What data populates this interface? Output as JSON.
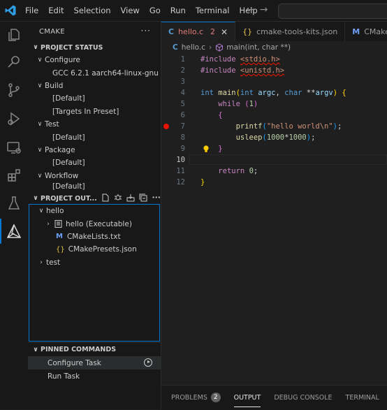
{
  "menu": [
    "File",
    "Edit",
    "Selection",
    "View",
    "Go",
    "Run",
    "Terminal",
    "Help"
  ],
  "sidebar": {
    "title": "CMAKE",
    "project_status": {
      "title": "PROJECT STATUS",
      "sections": [
        {
          "label": "Configure",
          "children": [
            "GCC 6.2.1 aarch64-linux-gnu"
          ]
        },
        {
          "label": "Build",
          "children": [
            "[Default]",
            "[Targets In Preset]"
          ]
        },
        {
          "label": "Test",
          "children": [
            "[Default]"
          ]
        },
        {
          "label": "Package",
          "children": [
            "[Default]"
          ]
        },
        {
          "label": "Workflow",
          "children": [
            "[Default]"
          ]
        }
      ]
    },
    "project_outline": {
      "title": "PROJECT OUT...",
      "items": [
        {
          "label": "hello"
        },
        {
          "label": "hello (Executable)"
        },
        {
          "label": "CMakeLists.txt"
        },
        {
          "label": "CMakePresets.json"
        },
        {
          "label": "test"
        }
      ]
    },
    "pinned": {
      "title": "PINNED COMMANDS",
      "items": [
        "Configure Task",
        "Run Task"
      ]
    }
  },
  "tabs": [
    {
      "label": "hello.c",
      "badge": "2",
      "icon": "C"
    },
    {
      "label": "cmake-tools-kits.json",
      "icon": "{}"
    },
    {
      "label": "CMakeLi",
      "icon": "M"
    }
  ],
  "breadcrumb": {
    "file": "hello.c",
    "symbol": "main(int, char **)"
  },
  "editor": {
    "line_numbers": [
      "1",
      "2",
      "3",
      "4",
      "5",
      "6",
      "7",
      "8",
      "9",
      "10",
      "11",
      "12"
    ],
    "current_line": "10",
    "breakpoint_line": "7"
  },
  "panel": {
    "tabs": [
      "PROBLEMS",
      "OUTPUT",
      "DEBUG CONSOLE",
      "TERMINAL",
      "PO"
    ],
    "problems_count": "2"
  },
  "colors": {
    "accent": "#0078d4",
    "error": "#e51400",
    "bg": "#1f1f1f"
  }
}
